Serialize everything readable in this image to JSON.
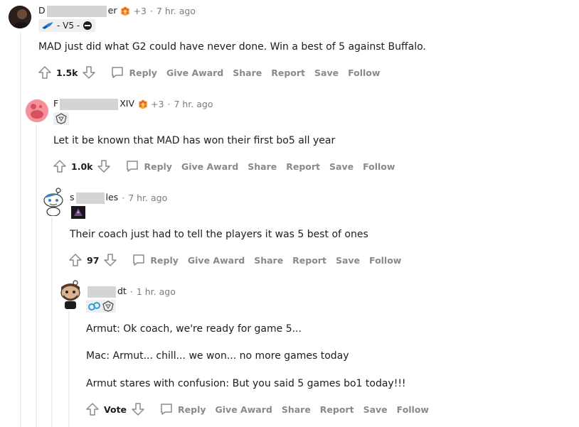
{
  "comments": [
    {
      "name_prefix": "D",
      "name_suffix": "er",
      "award_extra": "+3",
      "time": "7 hr. ago",
      "flair": "- V5 -",
      "body": [
        "MAD just did what G2 could have never done. Win a best of 5 against Buffalo."
      ],
      "score": "1.5k"
    },
    {
      "name_prefix": "F",
      "name_suffix": "XIV",
      "award_extra": "+3",
      "time": "7 hr. ago",
      "body": [
        "Let it be known that MAD has won their first bo5 all year"
      ],
      "score": "1.0k"
    },
    {
      "name_prefix": "s",
      "name_suffix": "les",
      "time": "7 hr. ago",
      "body": [
        "Their coach just had to tell the players it was 5 best of ones"
      ],
      "score": "97"
    },
    {
      "name_prefix": "",
      "name_suffix": "dt",
      "time": "1 hr. ago",
      "body": [
        "Armut: Ok coach, we're ready for game 5...",
        "Mac: Armut... chill... we won... no more games today",
        "Armut stares with confusion: But you said 5 games bo1 today!!!"
      ],
      "score": "Vote"
    }
  ],
  "actions": {
    "reply": "Reply",
    "give_award": "Give Award",
    "share": "Share",
    "report": "Report",
    "save": "Save",
    "follow": "Follow"
  },
  "separator": "·"
}
